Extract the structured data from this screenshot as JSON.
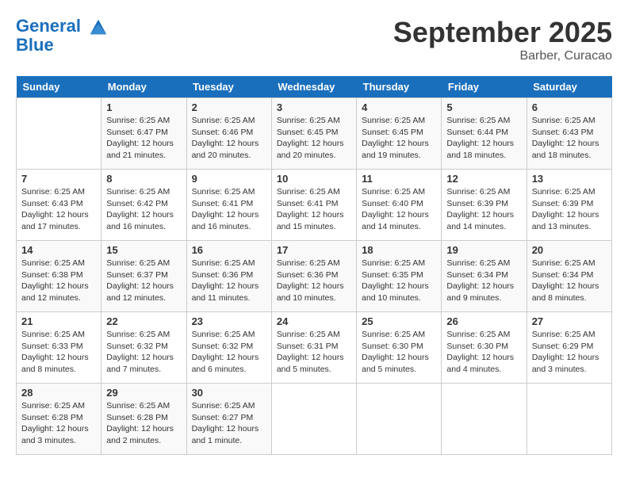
{
  "header": {
    "logo_line1": "General",
    "logo_line2": "Blue",
    "month": "September 2025",
    "location": "Barber, Curacao"
  },
  "days_of_week": [
    "Sunday",
    "Monday",
    "Tuesday",
    "Wednesday",
    "Thursday",
    "Friday",
    "Saturday"
  ],
  "weeks": [
    [
      {
        "num": "",
        "info": ""
      },
      {
        "num": "1",
        "info": "Sunrise: 6:25 AM\nSunset: 6:47 PM\nDaylight: 12 hours\nand 21 minutes."
      },
      {
        "num": "2",
        "info": "Sunrise: 6:25 AM\nSunset: 6:46 PM\nDaylight: 12 hours\nand 20 minutes."
      },
      {
        "num": "3",
        "info": "Sunrise: 6:25 AM\nSunset: 6:45 PM\nDaylight: 12 hours\nand 20 minutes."
      },
      {
        "num": "4",
        "info": "Sunrise: 6:25 AM\nSunset: 6:45 PM\nDaylight: 12 hours\nand 19 minutes."
      },
      {
        "num": "5",
        "info": "Sunrise: 6:25 AM\nSunset: 6:44 PM\nDaylight: 12 hours\nand 18 minutes."
      },
      {
        "num": "6",
        "info": "Sunrise: 6:25 AM\nSunset: 6:43 PM\nDaylight: 12 hours\nand 18 minutes."
      }
    ],
    [
      {
        "num": "7",
        "info": "Sunrise: 6:25 AM\nSunset: 6:43 PM\nDaylight: 12 hours\nand 17 minutes."
      },
      {
        "num": "8",
        "info": "Sunrise: 6:25 AM\nSunset: 6:42 PM\nDaylight: 12 hours\nand 16 minutes."
      },
      {
        "num": "9",
        "info": "Sunrise: 6:25 AM\nSunset: 6:41 PM\nDaylight: 12 hours\nand 16 minutes."
      },
      {
        "num": "10",
        "info": "Sunrise: 6:25 AM\nSunset: 6:41 PM\nDaylight: 12 hours\nand 15 minutes."
      },
      {
        "num": "11",
        "info": "Sunrise: 6:25 AM\nSunset: 6:40 PM\nDaylight: 12 hours\nand 14 minutes."
      },
      {
        "num": "12",
        "info": "Sunrise: 6:25 AM\nSunset: 6:39 PM\nDaylight: 12 hours\nand 14 minutes."
      },
      {
        "num": "13",
        "info": "Sunrise: 6:25 AM\nSunset: 6:39 PM\nDaylight: 12 hours\nand 13 minutes."
      }
    ],
    [
      {
        "num": "14",
        "info": "Sunrise: 6:25 AM\nSunset: 6:38 PM\nDaylight: 12 hours\nand 12 minutes."
      },
      {
        "num": "15",
        "info": "Sunrise: 6:25 AM\nSunset: 6:37 PM\nDaylight: 12 hours\nand 12 minutes."
      },
      {
        "num": "16",
        "info": "Sunrise: 6:25 AM\nSunset: 6:36 PM\nDaylight: 12 hours\nand 11 minutes."
      },
      {
        "num": "17",
        "info": "Sunrise: 6:25 AM\nSunset: 6:36 PM\nDaylight: 12 hours\nand 10 minutes."
      },
      {
        "num": "18",
        "info": "Sunrise: 6:25 AM\nSunset: 6:35 PM\nDaylight: 12 hours\nand 10 minutes."
      },
      {
        "num": "19",
        "info": "Sunrise: 6:25 AM\nSunset: 6:34 PM\nDaylight: 12 hours\nand 9 minutes."
      },
      {
        "num": "20",
        "info": "Sunrise: 6:25 AM\nSunset: 6:34 PM\nDaylight: 12 hours\nand 8 minutes."
      }
    ],
    [
      {
        "num": "21",
        "info": "Sunrise: 6:25 AM\nSunset: 6:33 PM\nDaylight: 12 hours\nand 8 minutes."
      },
      {
        "num": "22",
        "info": "Sunrise: 6:25 AM\nSunset: 6:32 PM\nDaylight: 12 hours\nand 7 minutes."
      },
      {
        "num": "23",
        "info": "Sunrise: 6:25 AM\nSunset: 6:32 PM\nDaylight: 12 hours\nand 6 minutes."
      },
      {
        "num": "24",
        "info": "Sunrise: 6:25 AM\nSunset: 6:31 PM\nDaylight: 12 hours\nand 5 minutes."
      },
      {
        "num": "25",
        "info": "Sunrise: 6:25 AM\nSunset: 6:30 PM\nDaylight: 12 hours\nand 5 minutes."
      },
      {
        "num": "26",
        "info": "Sunrise: 6:25 AM\nSunset: 6:30 PM\nDaylight: 12 hours\nand 4 minutes."
      },
      {
        "num": "27",
        "info": "Sunrise: 6:25 AM\nSunset: 6:29 PM\nDaylight: 12 hours\nand 3 minutes."
      }
    ],
    [
      {
        "num": "28",
        "info": "Sunrise: 6:25 AM\nSunset: 6:28 PM\nDaylight: 12 hours\nand 3 minutes."
      },
      {
        "num": "29",
        "info": "Sunrise: 6:25 AM\nSunset: 6:28 PM\nDaylight: 12 hours\nand 2 minutes."
      },
      {
        "num": "30",
        "info": "Sunrise: 6:25 AM\nSunset: 6:27 PM\nDaylight: 12 hours\nand 1 minute."
      },
      {
        "num": "",
        "info": ""
      },
      {
        "num": "",
        "info": ""
      },
      {
        "num": "",
        "info": ""
      },
      {
        "num": "",
        "info": ""
      }
    ]
  ]
}
